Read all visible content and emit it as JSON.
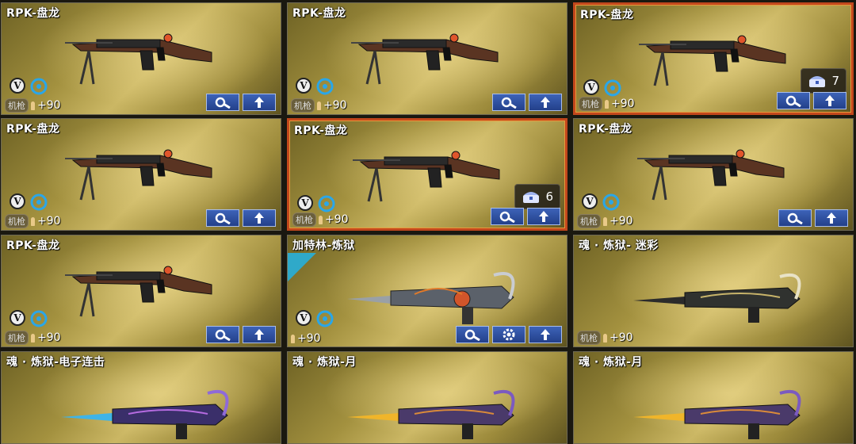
{
  "cards": [
    {
      "name": "RPK-盘龙",
      "type": "机枪",
      "bonus": "+90",
      "selected": false,
      "count": ""
    },
    {
      "name": "RPK-盘龙",
      "type": "机枪",
      "bonus": "+90",
      "selected": false,
      "count": ""
    },
    {
      "name": "RPK-盘龙",
      "type": "机枪",
      "bonus": "+90",
      "selected": true,
      "count": "7"
    },
    {
      "name": "RPK-盘龙",
      "type": "机枪",
      "bonus": "+90",
      "selected": false,
      "count": ""
    },
    {
      "name": "RPK-盘龙",
      "type": "机枪",
      "bonus": "+90",
      "selected": true,
      "count": "6"
    },
    {
      "name": "RPK-盘龙",
      "type": "机枪",
      "bonus": "+90",
      "selected": false,
      "count": ""
    },
    {
      "name": "RPK-盘龙",
      "type": "机枪",
      "bonus": "+90",
      "selected": false,
      "count": ""
    },
    {
      "name": "加特林-炼狱",
      "type": "",
      "bonus": "+90",
      "selected": false,
      "count": ""
    },
    {
      "name": "魂 · 炼狱- 迷彩",
      "type": "机枪",
      "bonus": "+90",
      "selected": false,
      "count": ""
    },
    {
      "name": "魂 · 炼狱-电子连击",
      "type": "",
      "bonus": "",
      "selected": false,
      "count": ""
    },
    {
      "name": "魂 · 炼狱-月",
      "type": "",
      "bonus": "",
      "selected": false,
      "count": ""
    },
    {
      "name": "魂 · 炼狱-月",
      "type": "",
      "bonus": "",
      "selected": false,
      "count": ""
    }
  ],
  "icons": {
    "v_badge": "V",
    "upgrade": "wrench-gear-icon",
    "promote": "up-arrow-icon",
    "settings": "gear-icon",
    "steering": "wheel-icon",
    "chest": "chest-icon"
  },
  "colors": {
    "selected_border": "#c2471c",
    "button": "#2f52a0"
  }
}
